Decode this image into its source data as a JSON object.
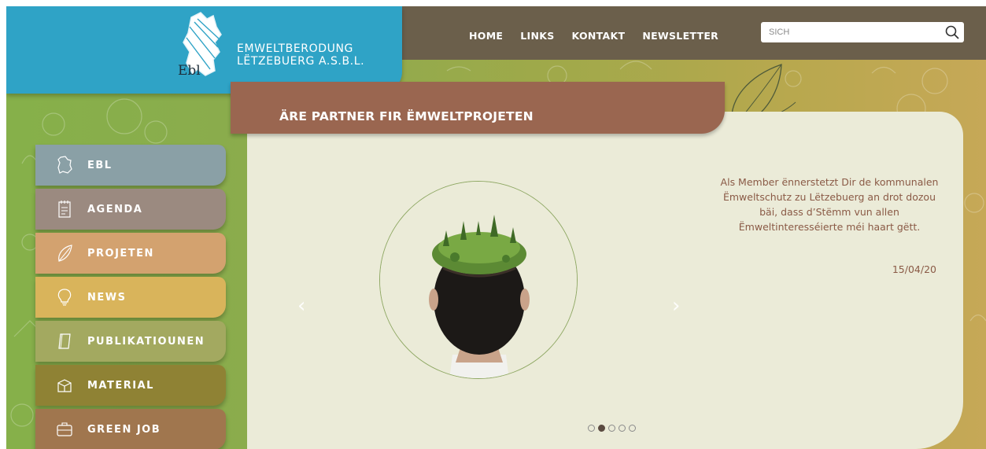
{
  "logo": {
    "line1": "EMWELTBERODUNG",
    "line2": "LËTZEBUERG A.S.B.L.",
    "mark": "Ebl"
  },
  "nav": [
    {
      "label": "HOME"
    },
    {
      "label": "LINKS"
    },
    {
      "label": "KONTAKT"
    },
    {
      "label": "NEWSLETTER"
    }
  ],
  "search": {
    "placeholder": "SICH",
    "icon": "search-icon"
  },
  "banner": {
    "title": "ÄRE PARTNER FIR ËMWELTPROJETEN"
  },
  "sidebar": {
    "items": [
      {
        "label": "EBL",
        "icon": "luxembourg-map-icon",
        "color": "#8aa0a6"
      },
      {
        "label": "AGENDA",
        "icon": "notepad-icon",
        "color": "#9b8a80"
      },
      {
        "label": "PROJETEN",
        "icon": "leaf-icon",
        "color": "#d3a26f"
      },
      {
        "label": "NEWS",
        "icon": "lightbulb-icon",
        "color": "#d9b45b"
      },
      {
        "label": "PUBLIKATIOUNEN",
        "icon": "document-icon",
        "color": "#a3a960"
      },
      {
        "label": "MATERIAL",
        "icon": "box-icon",
        "color": "#8f8234"
      },
      {
        "label": "GREEN JOB",
        "icon": "briefcase-icon",
        "color": "#a0764e"
      }
    ]
  },
  "slider": {
    "text": "Als Member ënnerstetzt Dir de kommunalen Ëmweltschutz zu Lëtzebuerg an drot dozou bäi, dass d’Stëmm vun allen Ëmweltinteresséierte méi haart gëtt.",
    "date": "15/04/20",
    "prev_icon": "chevron-left-icon",
    "next_icon": "chevron-right-icon",
    "prev_glyph": "‹",
    "next_glyph": "›",
    "dots": 5,
    "active_dot": 1
  },
  "colors": {
    "logo_bg": "#2fa3c6",
    "topbar": "#6b5f4b",
    "banner": "#9a6650",
    "content_bg": "#ebebd8",
    "text_accent": "#8a5a46"
  }
}
